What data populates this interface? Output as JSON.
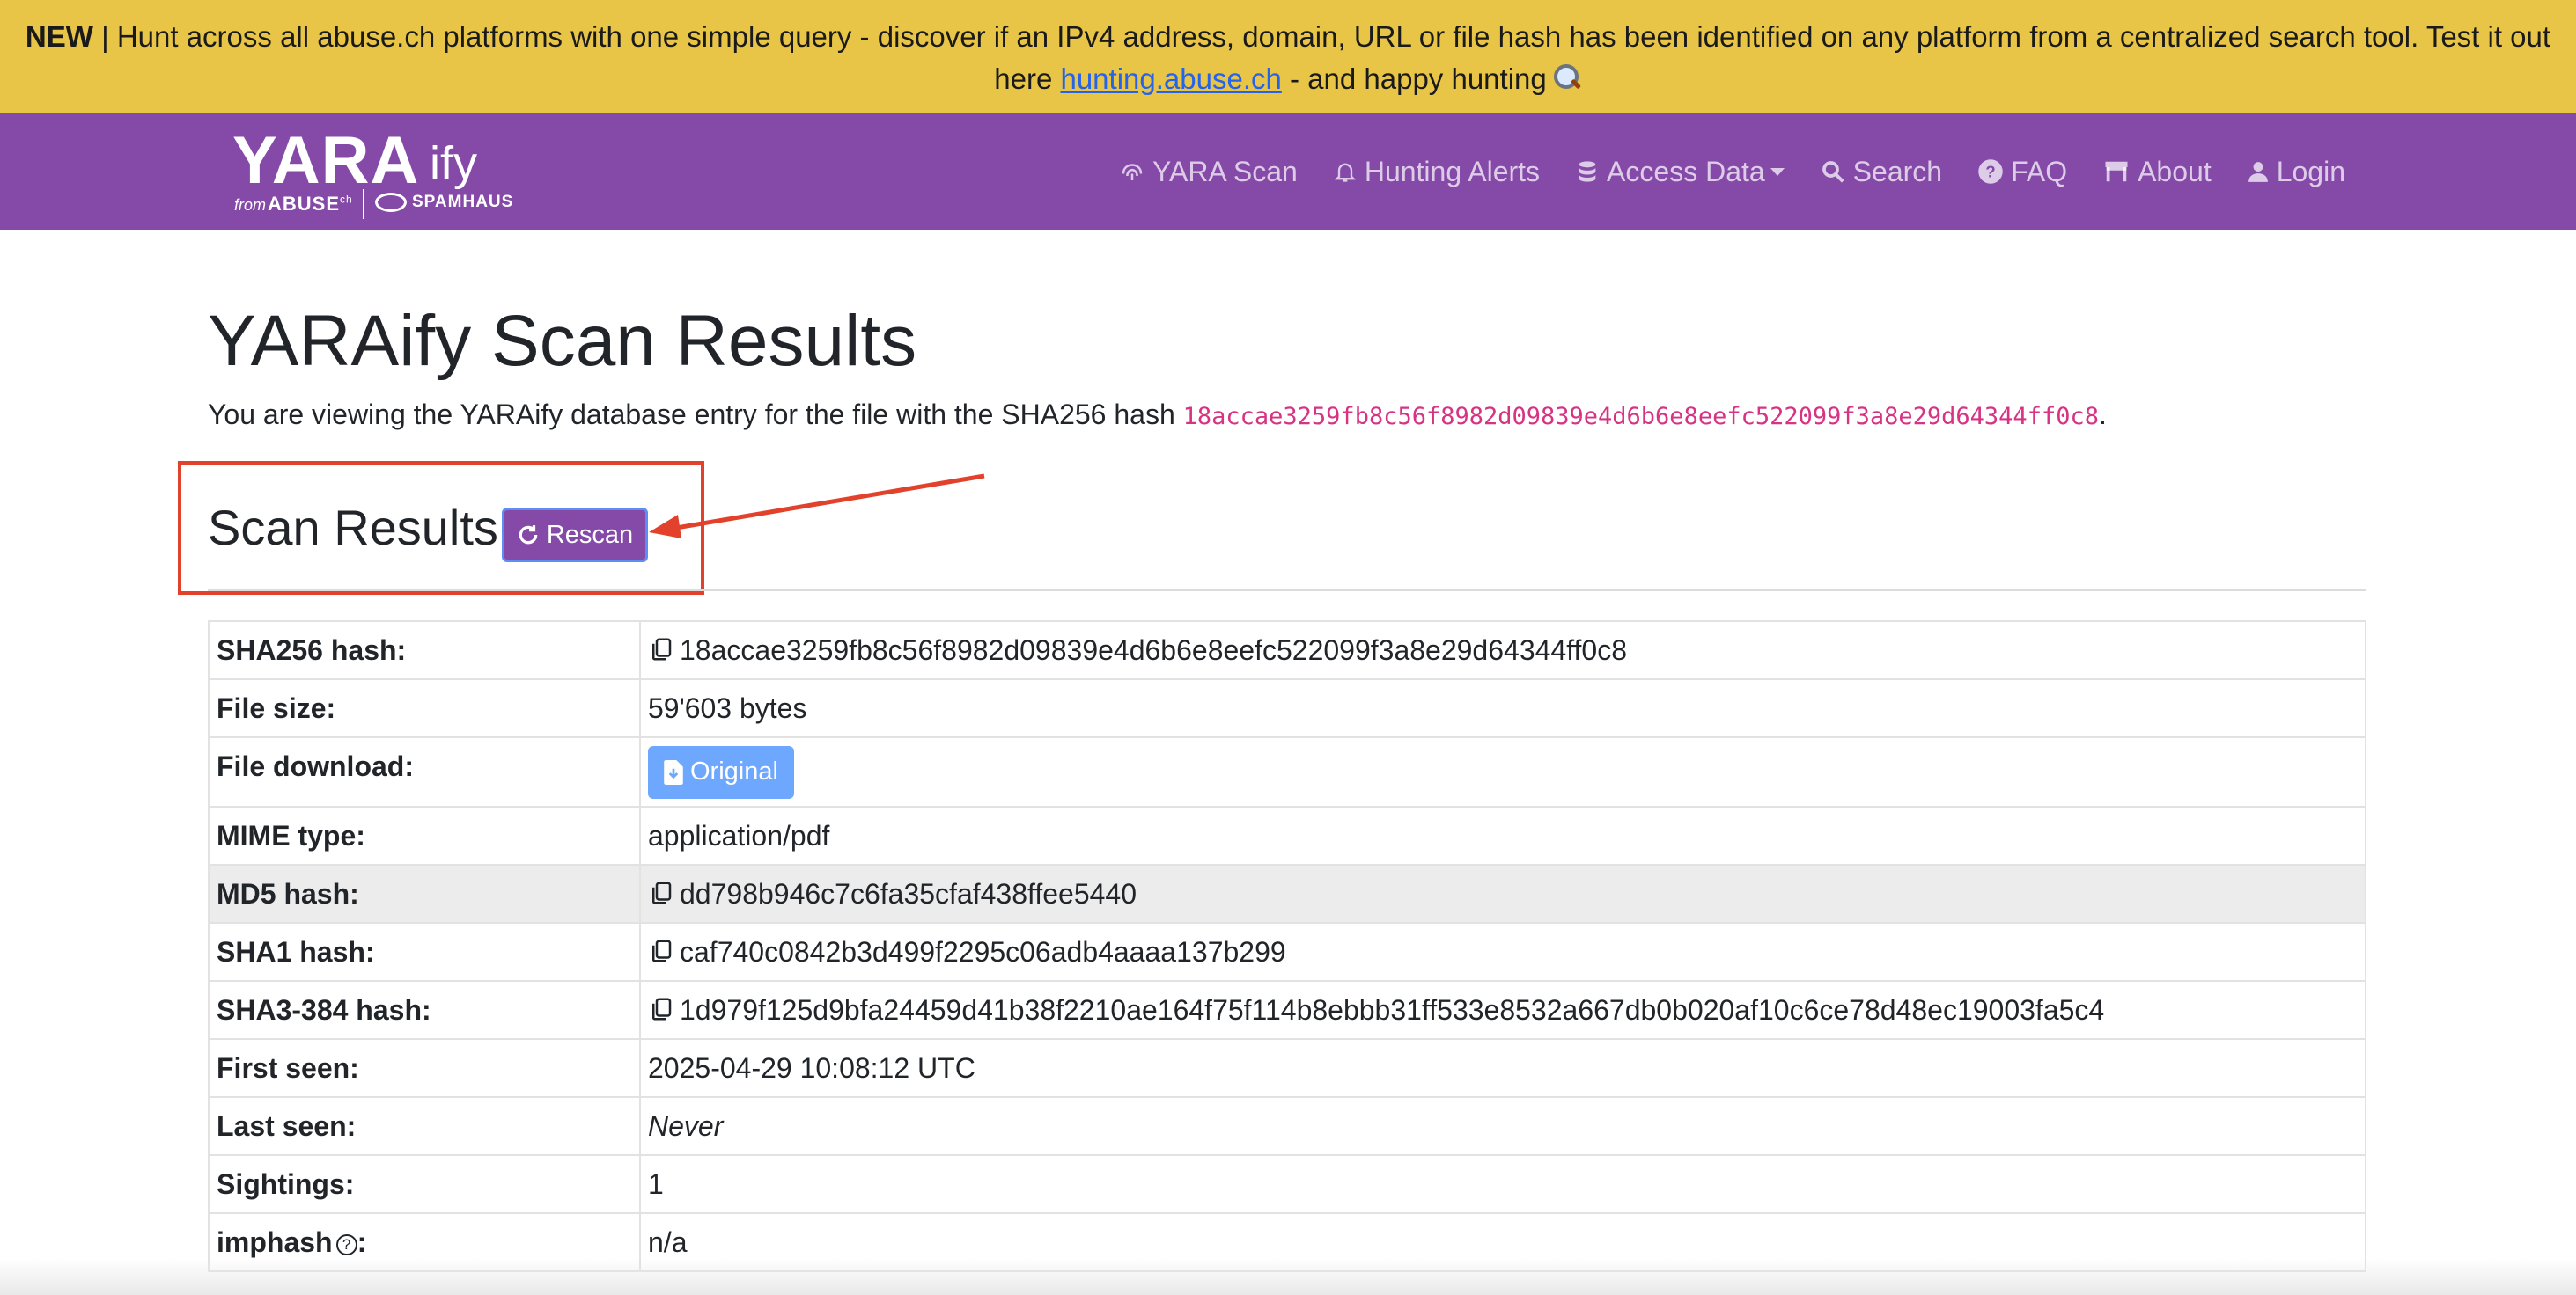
{
  "banner": {
    "new_label": "NEW",
    "text_before_link": " | Hunt across all abuse.ch platforms with one simple query - discover if an IPv4 address, domain, URL or file hash has been identified on any platform from a centralized search tool. Test it out here ",
    "link_text": "hunting.abuse.ch",
    "text_after_link": " - and happy hunting",
    "icon": "magnifier-icon"
  },
  "logo": {
    "main": "YARA",
    "suffix": "ify",
    "from": "from",
    "abuse": "ABUSE",
    "abuse_sup": "ch",
    "partner": "SPAMHAUS"
  },
  "nav": {
    "items": [
      {
        "label": "YARA Scan",
        "icon": "fingerprint-icon"
      },
      {
        "label": "Hunting Alerts",
        "icon": "bell-icon"
      },
      {
        "label": "Access Data",
        "icon": "database-icon"
      },
      {
        "label": "Search",
        "icon": "search-icon"
      },
      {
        "label": "FAQ",
        "icon": "question-circle-icon"
      },
      {
        "label": "About",
        "icon": "shop-icon"
      },
      {
        "label": "Login",
        "icon": "user-icon"
      }
    ]
  },
  "page": {
    "title": "YARAify Scan Results",
    "intro_text": "You are viewing the YARAify database entry for the file with the SHA256 hash ",
    "intro_hash": "18accae3259fb8c56f8982d09839e4d6b6e8eefc522099f3a8e29d64344ff0c8",
    "intro_end": ".",
    "section_title": "Scan Results",
    "rescan_label": "Rescan"
  },
  "details": {
    "sha256_key": "SHA256 hash:",
    "sha256_val": "18accae3259fb8c56f8982d09839e4d6b6e8eefc522099f3a8e29d64344ff0c8",
    "size_key": "File size:",
    "size_val": "59'603 bytes",
    "download_key": "File download:",
    "download_label": "Original",
    "mime_key": "MIME type:",
    "mime_val": "application/pdf",
    "md5_key": "MD5 hash:",
    "md5_val": "dd798b946c7c6fa35cfaf438ffee5440",
    "sha1_key": "SHA1 hash:",
    "sha1_val": "caf740c0842b3d499f2295c06adb4aaaa137b299",
    "sha3_key": "SHA3-384 hash:",
    "sha3_val": "1d979f125d9bfa24459d41b38f2210ae164f75f114b8ebbb31ff533e8532a667db0b020af10c6ce78d48ec19003fa5c4",
    "first_key": "First seen:",
    "first_val": "2025-04-29 10:08:12 UTC",
    "last_key": "Last seen:",
    "last_val": "Never",
    "sightings_key": "Sightings:",
    "sightings_val": "1",
    "imphash_key": "imphash",
    "imphash_suffix": ":",
    "imphash_help": "?",
    "imphash_val": "n/a"
  },
  "colors": {
    "banner": "#e8c547",
    "navbar": "#8549a8",
    "annotation": "#e2412b",
    "hash": "#d63384",
    "download_button": "#6ea8fe"
  }
}
